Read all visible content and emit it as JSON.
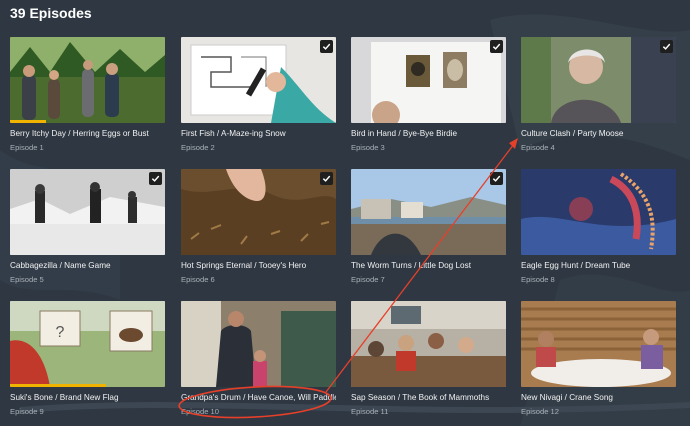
{
  "page": {
    "title": "39 Episodes"
  },
  "colors": {
    "progress": "#f0b400",
    "annotation": "#e6402a",
    "background": "#2e3742"
  },
  "episodes": [
    {
      "title": "Berry Itchy Day / Herring Eggs or Bust",
      "number": "Episode 1",
      "watched": false,
      "progress": 0.23,
      "thumb": "forest-kids"
    },
    {
      "title": "First Fish / A-Maze-ing Snow",
      "number": "Episode 2",
      "watched": true,
      "progress": 0,
      "thumb": "drawing-maze"
    },
    {
      "title": "Bird in Hand / Bye-Bye Birdie",
      "number": "Episode 3",
      "watched": true,
      "progress": 0,
      "thumb": "bird-book"
    },
    {
      "title": "Culture Clash / Party Moose",
      "number": "Episode 4",
      "watched": true,
      "progress": 0,
      "thumb": "elder-woman"
    },
    {
      "title": "Cabbagezilla / Name Game",
      "number": "Episode 5",
      "watched": true,
      "progress": 0,
      "thumb": "igloo-photo"
    },
    {
      "title": "Hot Springs Eternal / Tooey's Hero",
      "number": "Episode 6",
      "watched": true,
      "progress": 0,
      "thumb": "hand-soil"
    },
    {
      "title": "The Worm Turns / Little Dog Lost",
      "number": "Episode 7",
      "watched": true,
      "progress": 0,
      "thumb": "coast-village"
    },
    {
      "title": "Eagle Egg Hunt / Dream Tube",
      "number": "Episode 8",
      "watched": false,
      "progress": 0,
      "thumb": "beadwork"
    },
    {
      "title": "Suki's Bone / Brand New Flag",
      "number": "Episode 9",
      "watched": false,
      "progress": 0.62,
      "thumb": "signs-field"
    },
    {
      "title": "Grandpa's Drum / Have Canoe, Will Paddle",
      "number": "Episode 10",
      "watched": false,
      "progress": 0,
      "thumb": "man-child"
    },
    {
      "title": "Sap Season / The Book of Mammoths",
      "number": "Episode 11",
      "watched": false,
      "progress": 0,
      "thumb": "classroom"
    },
    {
      "title": "New Nivagi / Crane Song",
      "number": "Episode 12",
      "watched": false,
      "progress": 0,
      "thumb": "cabin-table"
    }
  ]
}
